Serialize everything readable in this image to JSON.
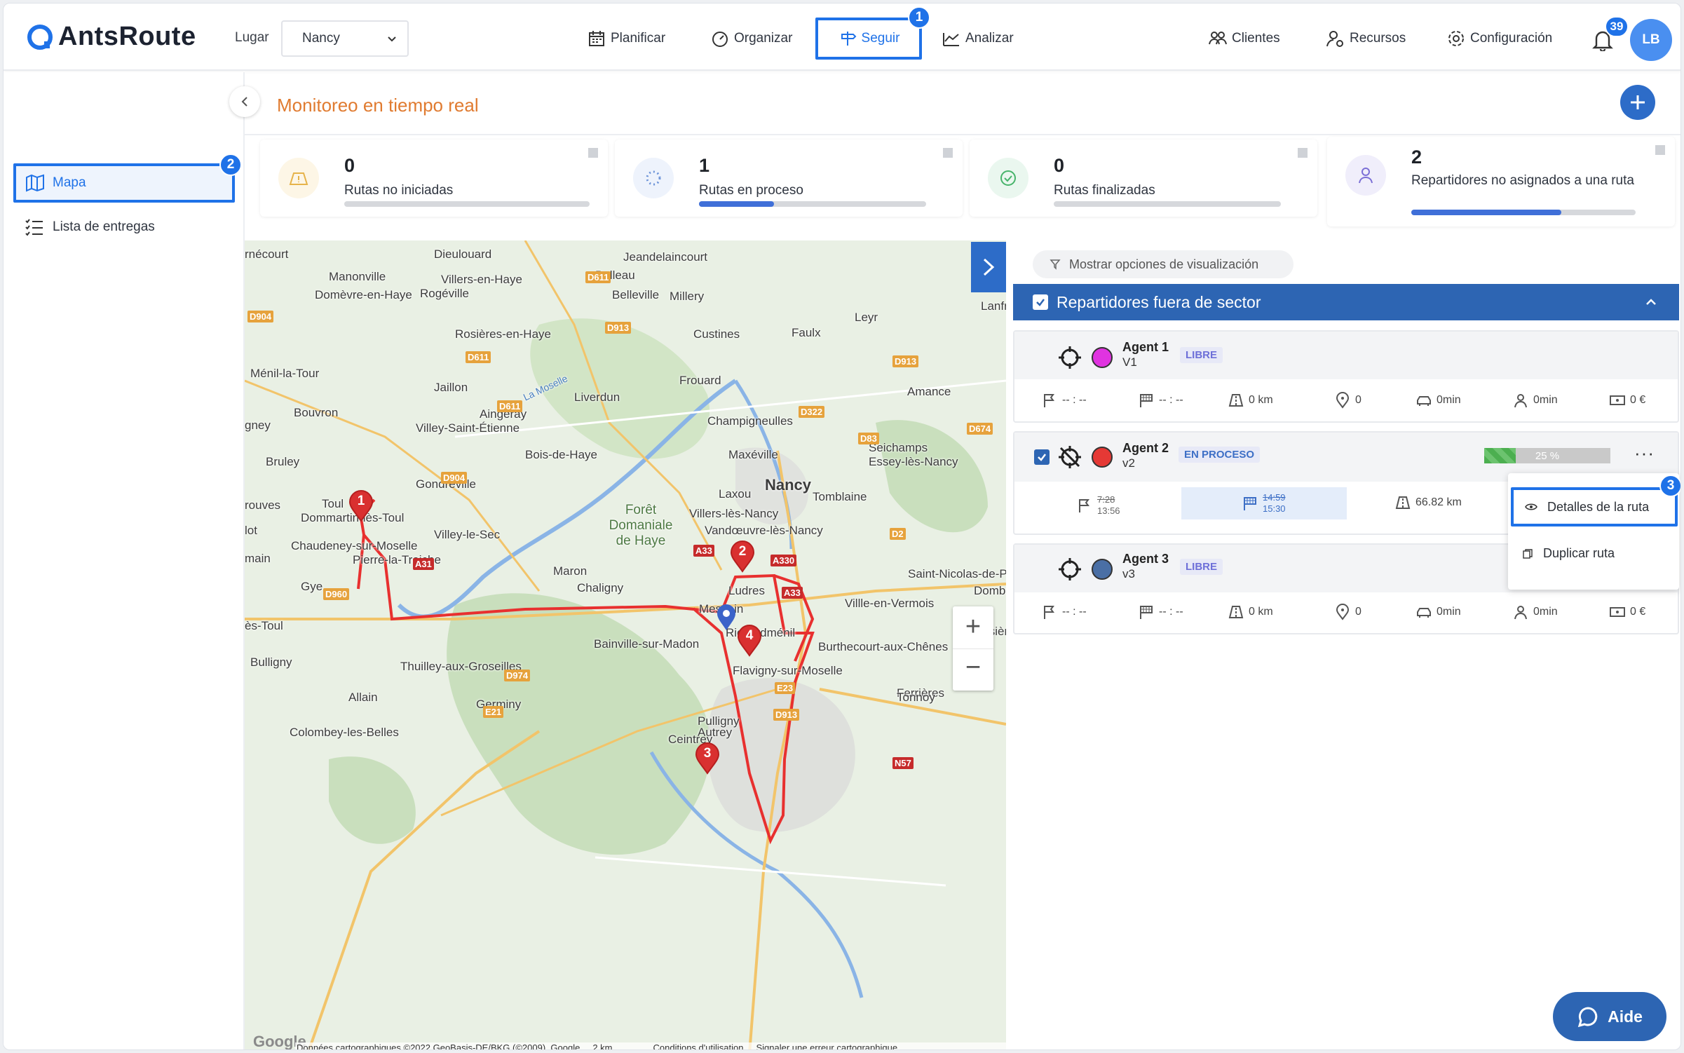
{
  "app": {
    "logo": "AntsRoute",
    "accent": "#1f72e8",
    "title_color": "#e07b30"
  },
  "header": {
    "lugar_label": "Lugar",
    "lugar_value": "Nancy",
    "nav": [
      {
        "label": "Planificar"
      },
      {
        "label": "Organizar"
      },
      {
        "label": "Seguir"
      },
      {
        "label": "Analizar"
      }
    ],
    "right_nav": [
      {
        "label": "Clientes"
      },
      {
        "label": "Recursos"
      },
      {
        "label": "Configuración"
      }
    ],
    "notif_count": "39",
    "avatar": "LB"
  },
  "steps": [
    "1",
    "2",
    "3"
  ],
  "sidebar": {
    "items": [
      {
        "label": "Mapa"
      },
      {
        "label": "Lista de entregas"
      }
    ]
  },
  "page": {
    "title": "Monitoreo en tiempo real"
  },
  "kpis": [
    {
      "value": "0",
      "label": "Rutas no iniciadas",
      "progress": 0
    },
    {
      "value": "1",
      "label": "Rutas en proceso",
      "progress": 0.33
    },
    {
      "value": "0",
      "label": "Rutas finalizadas",
      "progress": 0
    },
    {
      "value": "2",
      "label": "Repartidores no asignados a una ruta",
      "progress": 0.67
    }
  ],
  "panel": {
    "filter_label": "Mostrar opciones de visualización",
    "section_title": "Repartidores fuera de sector",
    "agents": [
      {
        "name": "Agent 1",
        "vehicle": "V1",
        "status": "LIBRE",
        "color": "#e033e0",
        "start": "-- : --",
        "end": "-- : --",
        "distance": "0 km",
        "stops": "0",
        "drive": "0min",
        "work": "0min",
        "cost": "0 €"
      },
      {
        "name": "Agent 2",
        "vehicle": "v2",
        "status": "EN PROCESO",
        "color": "#e53935",
        "progress": "25 %",
        "start_planned": "7:28",
        "start_actual": "13:56",
        "end_planned": "14:59",
        "end_actual": "15:30",
        "distance": "66.82 km"
      },
      {
        "name": "Agent 3",
        "vehicle": "v3",
        "status": "LIBRE",
        "color": "#4a6fa5",
        "start": "-- : --",
        "end": "-- : --",
        "distance": "0 km",
        "stops": "0",
        "drive": "0min",
        "work": "0min",
        "cost": "0 €"
      }
    ],
    "menu": [
      {
        "label": "Detalles de la ruta"
      },
      {
        "label": "Duplicar ruta"
      }
    ]
  },
  "map": {
    "labels": [
      "Dieulouard",
      "Jeandelaincourt",
      "Manonville",
      "Villers-en-Haye",
      "Belleau",
      "Domèvre-en-Haye",
      "Rogéville",
      "Belleville",
      "Millery",
      "Lanfr",
      "Leyr",
      "Rosières-en-Haye",
      "Custines",
      "Faulx",
      "Ménil-la-Tour",
      "Jaillon",
      "La Moselle",
      "Liverdun",
      "Frouard",
      "Amance",
      "Bouvron",
      "Aingeray",
      "Villey-Saint-Étienne",
      "Champigneulles",
      "Bois-de-Haye",
      "Maxéville",
      "Seichamps",
      "Essey-lès-Nancy",
      "Bruley",
      "Gondreville",
      "Nancy",
      "Laxou",
      "Tomblaine",
      "Toul",
      "Dommartin-lès-Toul",
      "Forêt Domaniale de Haye",
      "Villers-lès-Nancy",
      "Vandœuvre-lès-Nancy",
      "Villey-le-Sec",
      "Chaudeney-sur-Moselle",
      "Pierre-la-Treiche",
      "Maron",
      "Saint-Nicolas-de-P",
      "Gye",
      "Chaligny",
      "Ludres",
      "Dombasle",
      "Villle-en-Vermois",
      "Messein",
      "Richardménil",
      "Rosières-",
      "Bainville-sur-Madon",
      "Burthecourt-aux-Chênes",
      "Bulligny",
      "Thuilley-aux-Groseilles",
      "Flavigny-sur-Moselle",
      "Ferrières",
      "Allain",
      "Germiny",
      "Tonnoy",
      "Pulligny",
      "Autrey",
      "Colombey-les-Belles",
      "Ceintrey",
      "rnécourt",
      "gney",
      "rouves",
      "lot",
      "main",
      "ès-Toul"
    ],
    "roads": [
      "D611",
      "D913",
      "D904",
      "D611",
      "D611",
      "D913",
      "D322",
      "D674",
      "D83",
      "D904",
      "D2",
      "A33",
      "A330",
      "A31",
      "D960",
      "A33",
      "D974",
      "E23",
      "E21",
      "D913",
      "N57"
    ],
    "markers": [
      "1",
      "2",
      "3",
      "4"
    ],
    "attribution": "Données cartographiques ©2022 GeoBasis-DE/BKG (©2009), Google",
    "scale": "2 km",
    "terms": "Conditions d'utilisation",
    "report": "Signaler une erreur cartographique",
    "zoom_in": "+",
    "zoom_out": "−"
  },
  "help": {
    "label": "Aide"
  }
}
